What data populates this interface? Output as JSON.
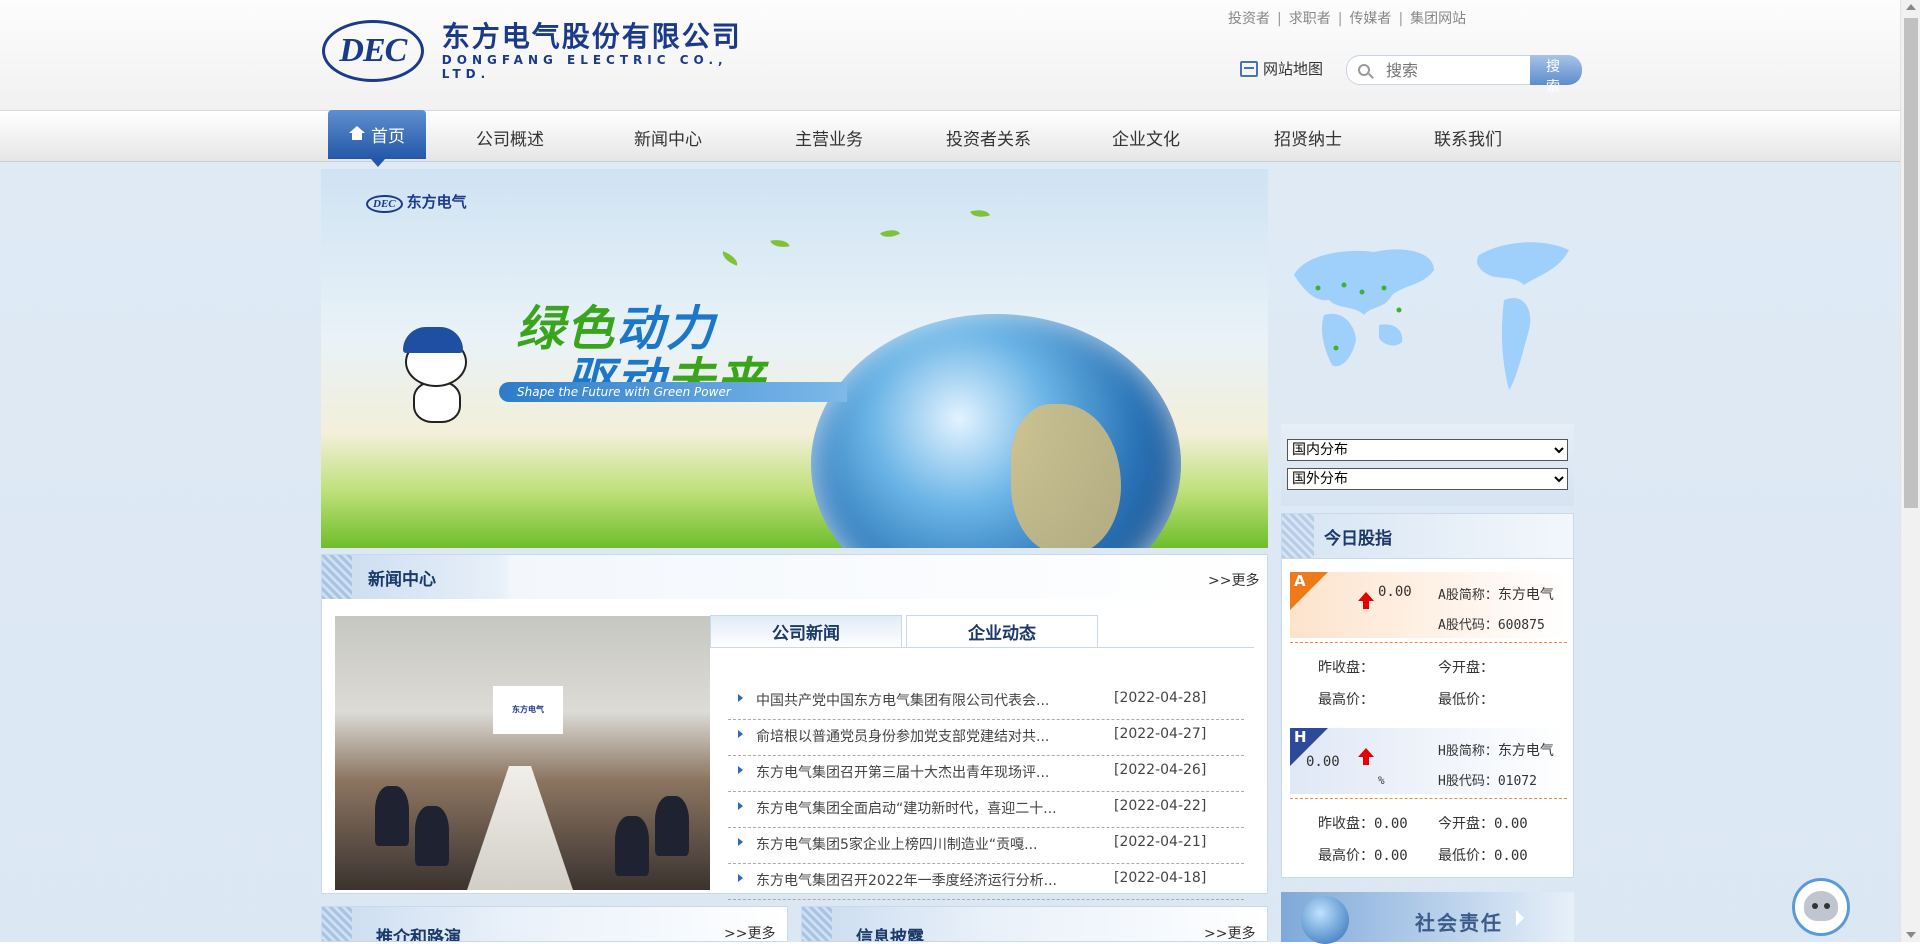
{
  "header": {
    "logo_abbr": "DEC",
    "logo_cn": "东方电气股份有限公司",
    "logo_en": "DONGFANG ELECTRIC CO., LTD.",
    "top_links": [
      "投资者",
      "求职者",
      "传媒者",
      "集团网站"
    ],
    "sitemap_label": "网站地图",
    "search_placeholder": "搜索",
    "search_button": "搜 索"
  },
  "nav": {
    "home": "首页",
    "items": [
      "公司概述",
      "新闻中心",
      "主营业务",
      "投资者关系",
      "企业文化",
      "招贤纳士",
      "联系我们"
    ]
  },
  "banner": {
    "logo_abbr": "DEC",
    "logo_cn": "东方电气",
    "line1_a": "绿色",
    "line1_b": "动力",
    "line2_a": "驱动",
    "line2_b": "未来",
    "subtitle": "Shape the Future with Green Power"
  },
  "news": {
    "title": "新闻中心",
    "more": ">>更多",
    "photo_screen_text": "东方电气",
    "tabs": [
      "公司新闻",
      "企业动态"
    ],
    "items": [
      {
        "title": "中国共产党中国东方电气集团有限公司代表会...",
        "date": "[2022-04-28]"
      },
      {
        "title": "俞培根以普通党员身份参加党支部党建结对共...",
        "date": "[2022-04-27]"
      },
      {
        "title": "东方电气集团召开第三届十大杰出青年现场评...",
        "date": "[2022-04-26]"
      },
      {
        "title": "东方电气集团全面启动“建功新时代，喜迎二十...",
        "date": "[2022-04-22]"
      },
      {
        "title": "东方电气集团5家企业上榜四川制造业“贡嘎...",
        "date": "[2022-04-21]"
      },
      {
        "title": "东方电气集团召开2022年一季度经济运行分析...",
        "date": "[2022-04-18]"
      }
    ]
  },
  "distribution": {
    "domestic": "国内分布",
    "overseas": "国外分布"
  },
  "stock": {
    "title": "今日股指",
    "a": {
      "badge": "A",
      "value": "0.00",
      "name_label": "A股简称：",
      "name": "东方电气",
      "code_label": "A股代码：",
      "code": "600875",
      "prev_close_label": "昨收盘：",
      "prev_close": "",
      "open_label": "今开盘：",
      "open": "",
      "high_label": "最高价：",
      "high": "",
      "low_label": "最低价：",
      "low": ""
    },
    "h": {
      "badge": "H",
      "value": "0.00",
      "percent": "%",
      "name_label": "H股简称：",
      "name": "东方电气",
      "code_label": "H股代码：",
      "code": "01072",
      "prev_close_label": "昨收盘：",
      "prev_close": "0.00",
      "open_label": "今开盘：",
      "open": "0.00",
      "high_label": "最高价：",
      "high": "0.00",
      "low_label": "最低价：",
      "low": "0.00"
    }
  },
  "social": {
    "title": "社会责任"
  },
  "bottom": {
    "left_title": "推介和路演",
    "right_title": "信息披露",
    "more": ">>更多"
  }
}
